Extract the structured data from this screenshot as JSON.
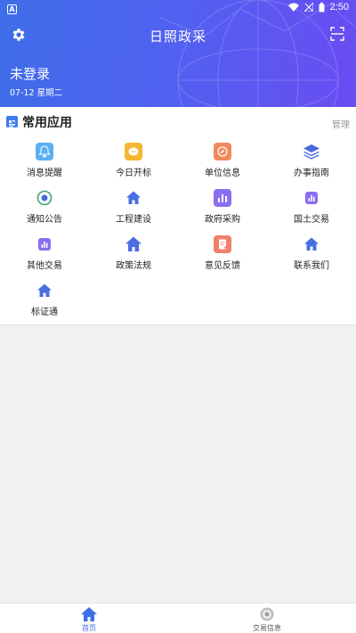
{
  "status_bar": {
    "app_badge": "A",
    "time": "2:50"
  },
  "header": {
    "title": "日照政采",
    "login_status": "未登录",
    "date": "07-12 星期二"
  },
  "section": {
    "title": "常用应用",
    "manage_label": "管理"
  },
  "apps": [
    {
      "label": "消息提醒"
    },
    {
      "label": "今日开标"
    },
    {
      "label": "单位信息"
    },
    {
      "label": "办事指南"
    },
    {
      "label": "通知公告"
    },
    {
      "label": "工程建设"
    },
    {
      "label": "政府采购"
    },
    {
      "label": "国土交易"
    },
    {
      "label": "其他交易"
    },
    {
      "label": "政策法规"
    },
    {
      "label": "意见反馈"
    },
    {
      "label": "联系我们"
    },
    {
      "label": "标证通"
    }
  ],
  "tabbar": {
    "home_label": "首页",
    "trade_label": "交易信息",
    "active_color": "#3d6fe6",
    "inactive_color": "#555555"
  },
  "colors": {
    "accent": "#4f62f0"
  }
}
